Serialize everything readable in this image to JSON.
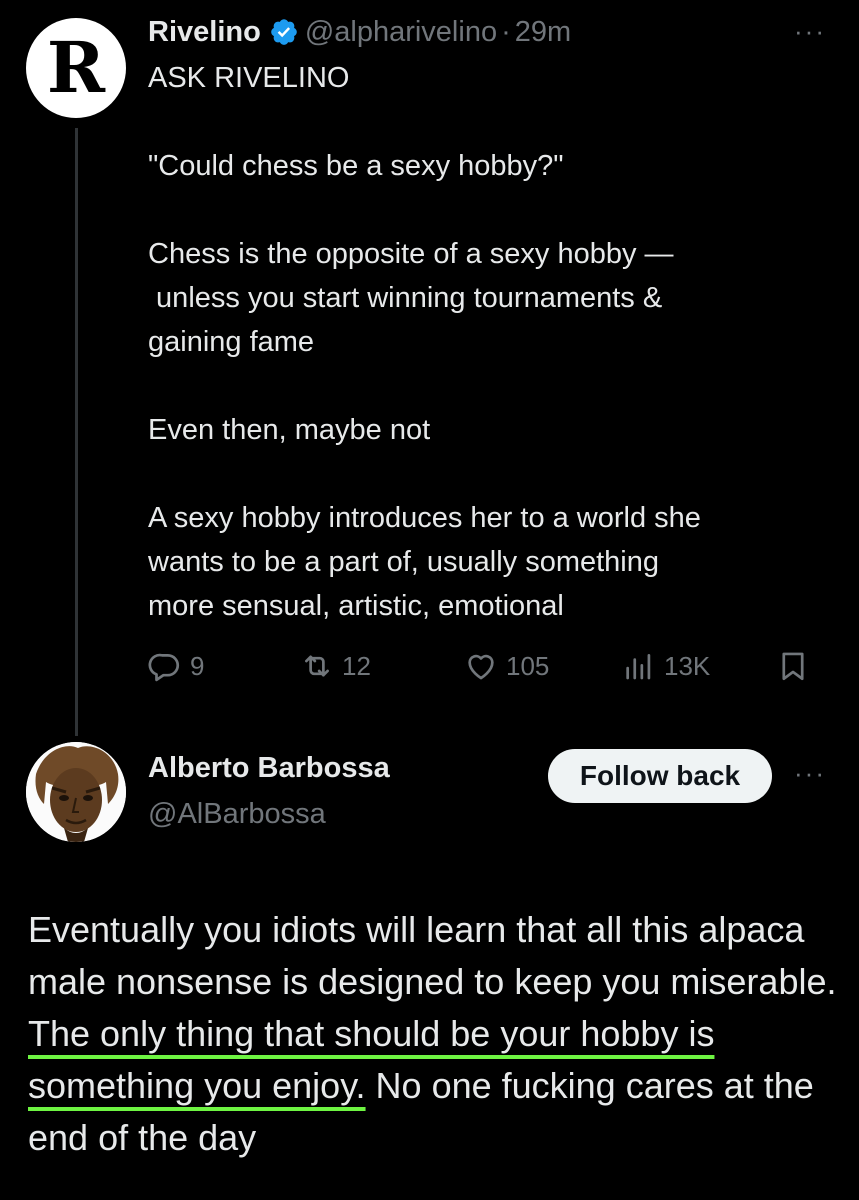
{
  "tweet": {
    "avatar_letter": "R",
    "author_name": "Rivelino",
    "author_handle": "@alpharivelino",
    "separator": "·",
    "time": "29m",
    "more_icon": "···",
    "lines": [
      "ASK RIVELINO",
      "",
      "\"Could chess be a sexy hobby?\"",
      "",
      "Chess is the opposite of a sexy hobby —",
      " unless you start winning tournaments &",
      "gaining fame",
      "",
      "Even then, maybe not",
      "",
      "A sexy hobby introduces her to a world she",
      "wants to be a part of, usually something",
      "more sensual, artistic, emotional"
    ],
    "actions": {
      "replies": "9",
      "reposts": "12",
      "likes": "105",
      "views": "13K"
    }
  },
  "reply": {
    "author_name": "Alberto Barbossa",
    "author_handle": "@AlBarbossa",
    "follow_label": "Follow back",
    "more_icon": "···",
    "text_before": "Eventually you idiots will learn that all this alpaca male nonsense is designed to keep you miserable. ",
    "text_highlight": "The only thing that should be your hobby is something you enjoy.",
    "text_after": " No one fucking cares at the end of the day"
  },
  "colors": {
    "background": "#000000",
    "text": "#e7e9ea",
    "muted": "#71767b",
    "verified": "#1d9bf0",
    "underline": "#6ef442"
  }
}
